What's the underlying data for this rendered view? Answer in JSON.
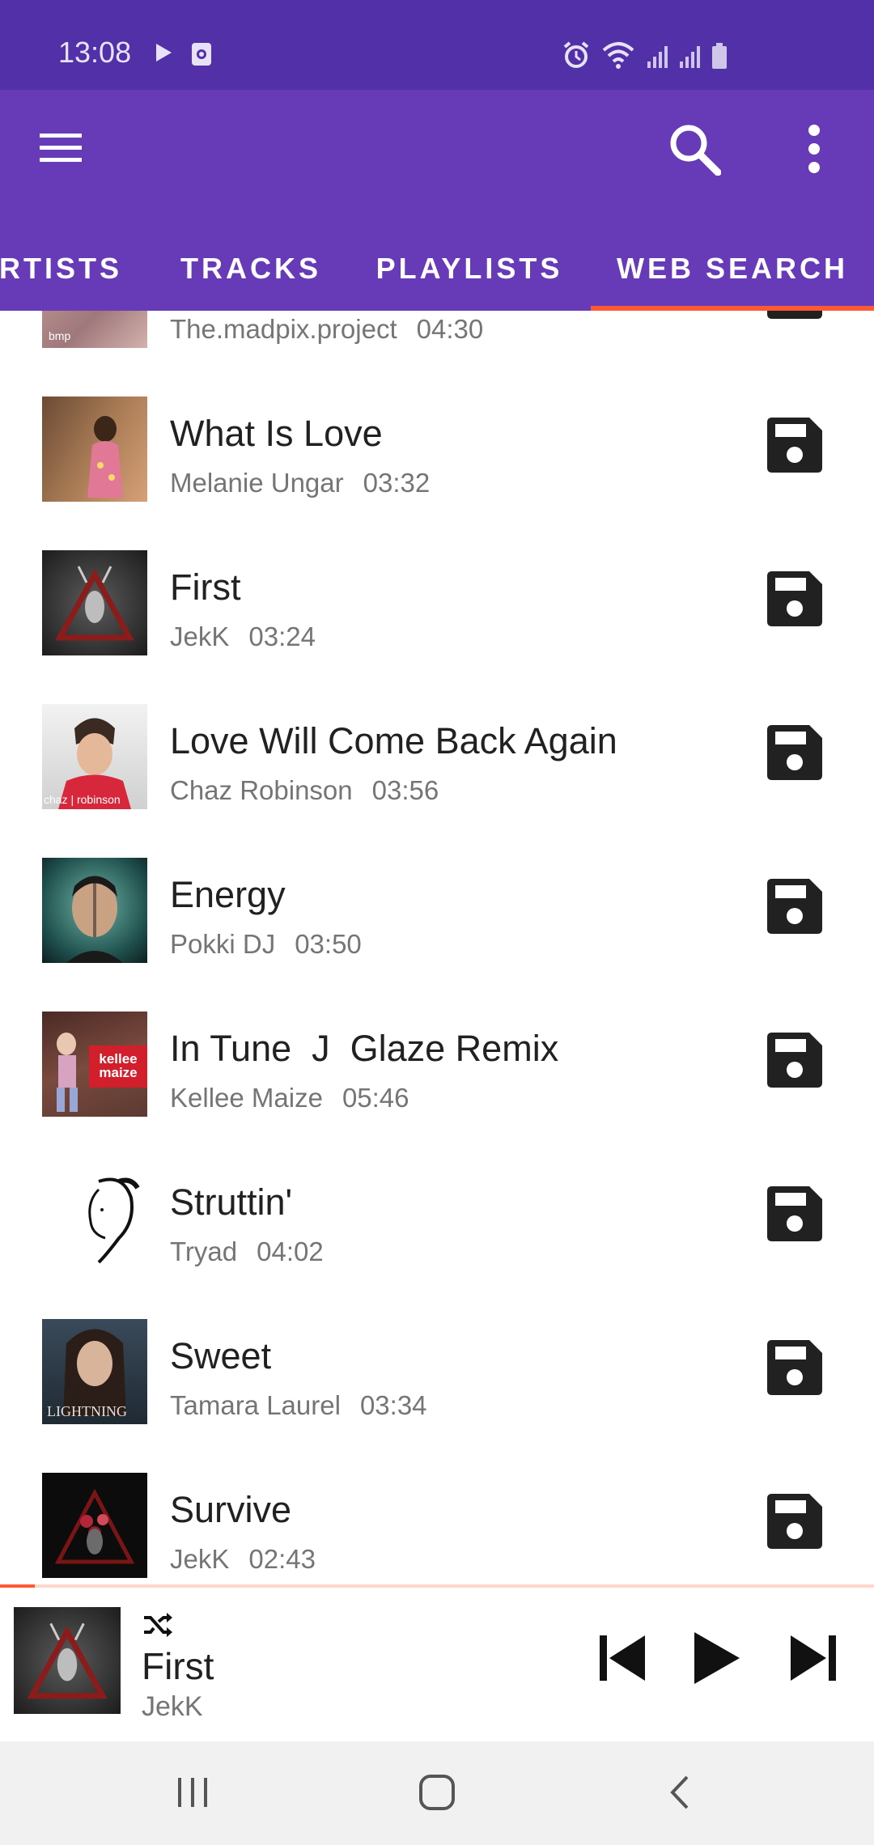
{
  "status_bar": {
    "time": "13:08",
    "left_icons": [
      "play-notification-icon",
      "screen-record-icon"
    ],
    "right_icons": [
      "alarm-icon",
      "wifi-icon",
      "signal-icon",
      "signal-icon",
      "battery-icon"
    ]
  },
  "app_bar": {
    "menu_icon": "menu-icon",
    "search_icon": "search-icon",
    "more_icon": "more-vert-icon"
  },
  "tabs": [
    {
      "label": "RTISTS",
      "selected": false
    },
    {
      "label": "TRACKS",
      "selected": false
    },
    {
      "label": "PLAYLISTS",
      "selected": false
    },
    {
      "label": "WEB SEARCH",
      "selected": true
    }
  ],
  "tracks": [
    {
      "title": "",
      "artist": "The.madpix.project",
      "duration": "04:30"
    },
    {
      "title": "What Is Love",
      "artist": "Melanie Ungar",
      "duration": "03:32"
    },
    {
      "title": "First",
      "artist": "JekK",
      "duration": "03:24"
    },
    {
      "title": "Love Will Come Back Again",
      "artist": "Chaz Robinson",
      "duration": "03:56",
      "thumb_text": "chaz | robinson"
    },
    {
      "title": "Energy",
      "artist": "Pokki DJ",
      "duration": "03:50"
    },
    {
      "title": "In Tune  J  Glaze Remix",
      "artist": "Kellee Maize",
      "duration": "05:46",
      "thumb_text": "kellee maize"
    },
    {
      "title": "Struttin'",
      "artist": "Tryad",
      "duration": "04:02"
    },
    {
      "title": "Sweet",
      "artist": "Tamara Laurel",
      "duration": "03:34",
      "thumb_text": "LIGHTNING"
    },
    {
      "title": "Survive",
      "artist": "JekK",
      "duration": "02:43"
    }
  ],
  "now_playing": {
    "title": "First",
    "artist": "JekK",
    "progress": 0.04,
    "shuffle_icon": "shuffle-icon"
  },
  "colors": {
    "status_bar": "#5130a8",
    "app_bar": "#673ab7",
    "accent": "#ff5a36",
    "nav_bar": "#f1f1f1"
  }
}
